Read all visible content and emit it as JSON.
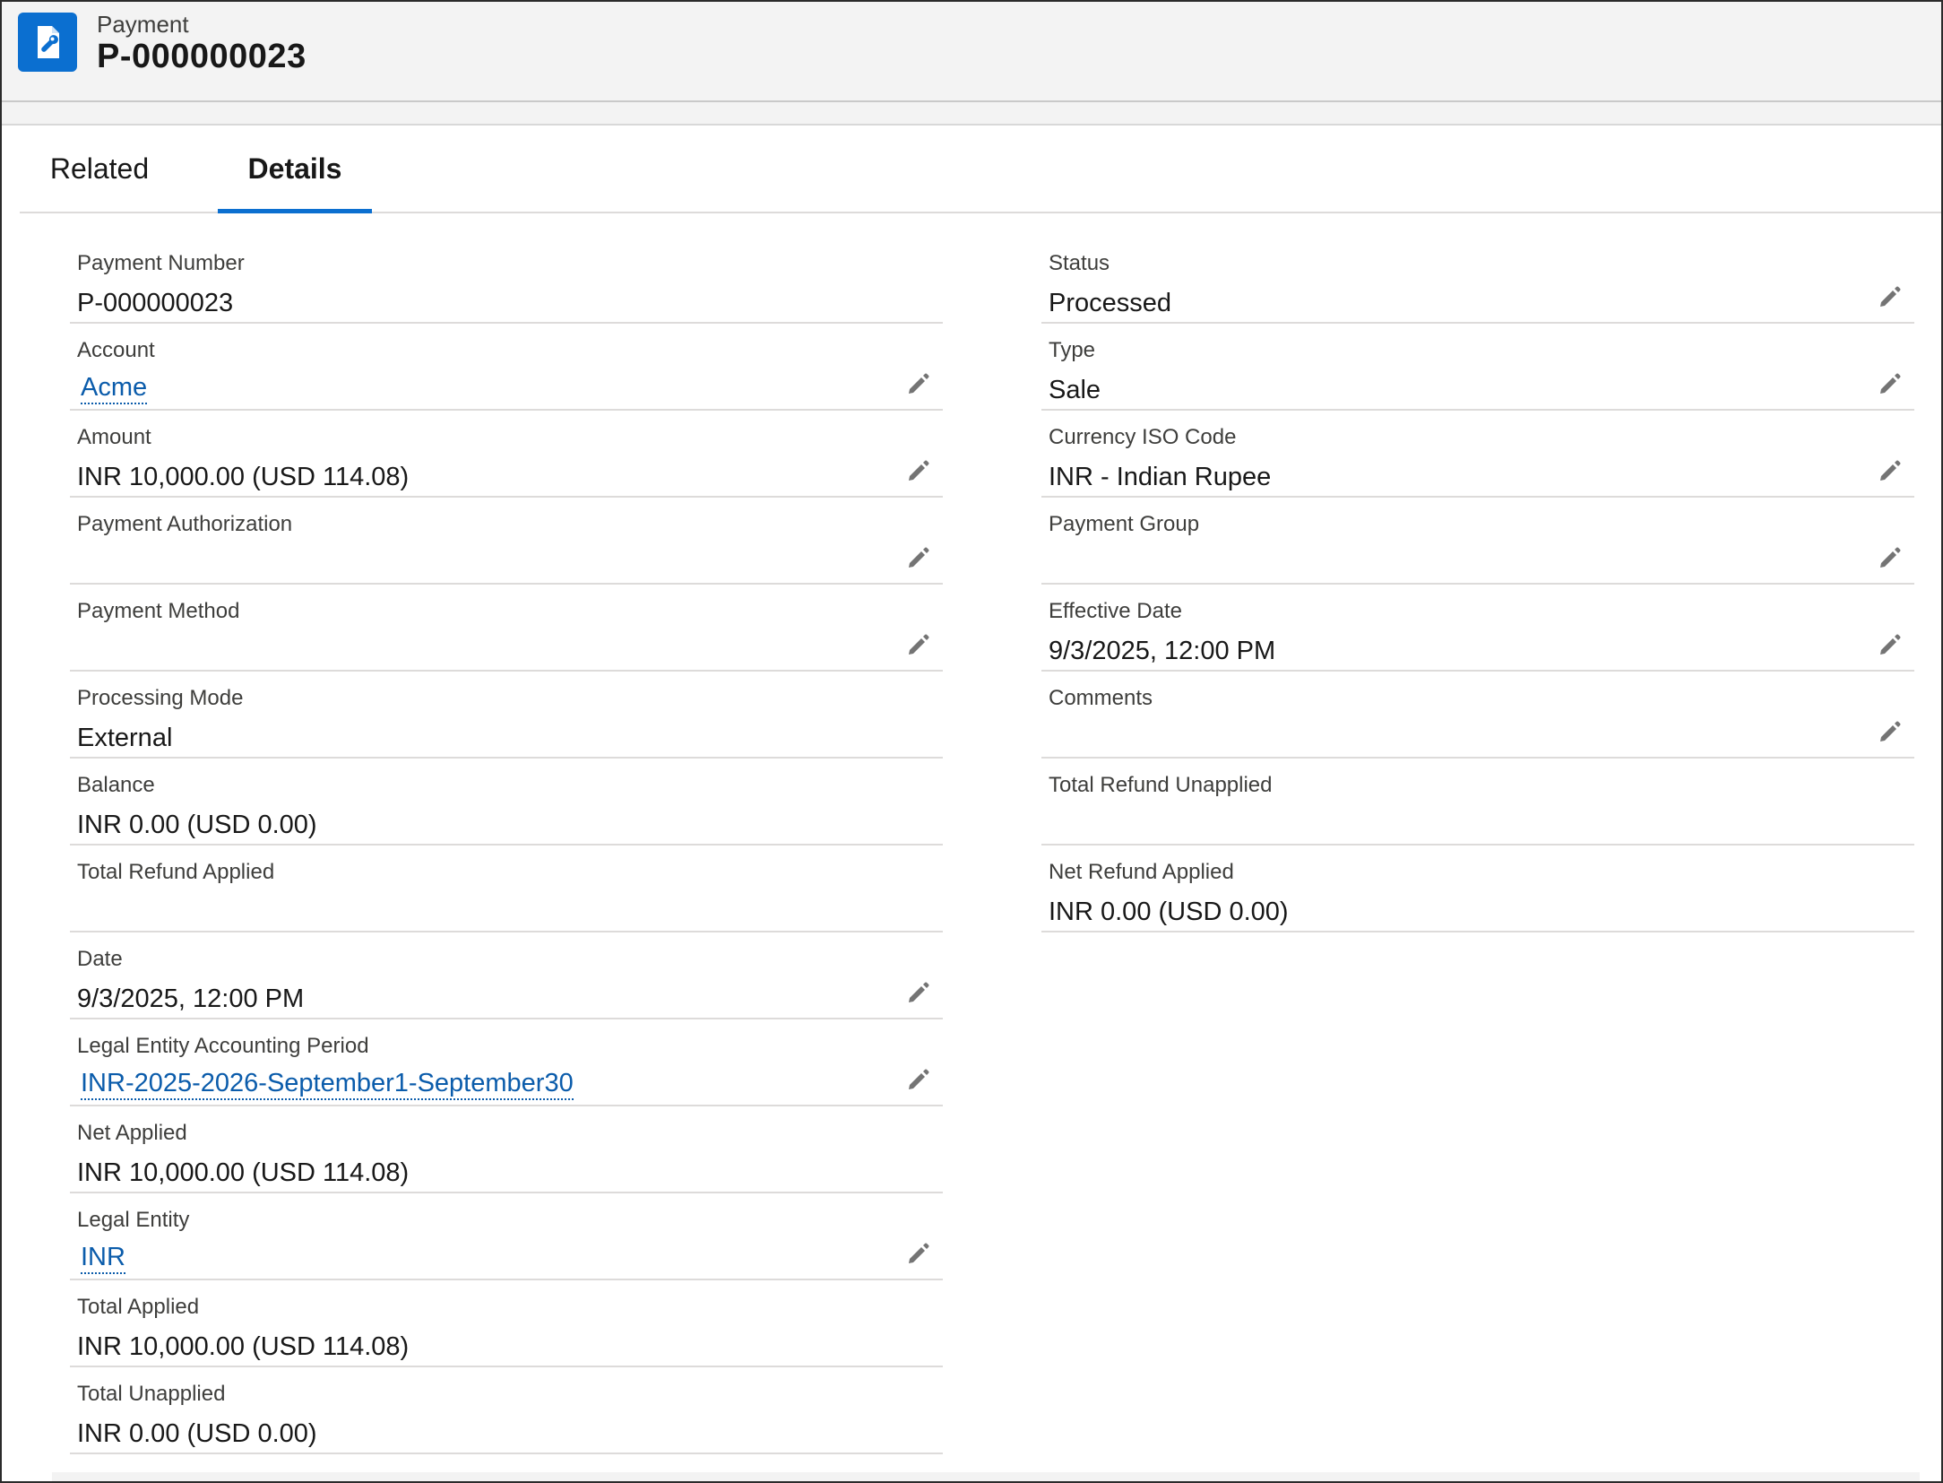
{
  "header": {
    "object_label": "Payment",
    "title": "P-000000023",
    "icon": "payment-wrench-icon"
  },
  "tabs": [
    {
      "label": "Related",
      "active": false
    },
    {
      "label": "Details",
      "active": true
    }
  ],
  "colors": {
    "accent": "#0b6fd0",
    "link": "#0b5cab"
  },
  "left_fields": [
    {
      "label": "Payment Number",
      "value": "P-000000023",
      "link": false,
      "editable": false
    },
    {
      "label": "Account",
      "value": "Acme",
      "link": true,
      "editable": true
    },
    {
      "label": "Amount",
      "value": "INR 10,000.00 (USD 114.08)",
      "link": false,
      "editable": true
    },
    {
      "label": "Payment Authorization",
      "value": "",
      "link": false,
      "editable": true
    },
    {
      "label": "Payment Method",
      "value": "",
      "link": false,
      "editable": true
    },
    {
      "label": "Processing Mode",
      "value": "External",
      "link": false,
      "editable": false
    },
    {
      "label": "Balance",
      "value": "INR 0.00 (USD 0.00)",
      "link": false,
      "editable": false
    },
    {
      "label": "Total Refund Applied",
      "value": "",
      "link": false,
      "editable": false
    },
    {
      "label": "Date",
      "value": "9/3/2025, 12:00 PM",
      "link": false,
      "editable": true
    },
    {
      "label": "Legal Entity Accounting Period",
      "value": "INR-2025-2026-September1-September30",
      "link": true,
      "editable": true
    },
    {
      "label": "Net Applied",
      "value": "INR 10,000.00 (USD 114.08)",
      "link": false,
      "editable": false
    },
    {
      "label": "Legal Entity",
      "value": "INR",
      "link": true,
      "editable": true
    },
    {
      "label": "Total Applied",
      "value": "INR 10,000.00 (USD 114.08)",
      "link": false,
      "editable": false
    },
    {
      "label": "Total Unapplied",
      "value": "INR 0.00 (USD 0.00)",
      "link": false,
      "editable": false
    }
  ],
  "right_fields": [
    {
      "label": "Status",
      "value": "Processed",
      "link": false,
      "editable": true
    },
    {
      "label": "Type",
      "value": "Sale",
      "link": false,
      "editable": true
    },
    {
      "label": "Currency ISO Code",
      "value": "INR - Indian Rupee",
      "link": false,
      "editable": true
    },
    {
      "label": "Payment Group",
      "value": "",
      "link": false,
      "editable": true
    },
    {
      "label": "Effective Date",
      "value": "9/3/2025, 12:00 PM",
      "link": false,
      "editable": true
    },
    {
      "label": "Comments",
      "value": "",
      "link": false,
      "editable": true
    },
    {
      "label": "Total Refund Unapplied",
      "value": "",
      "link": false,
      "editable": false
    },
    {
      "label": "Net Refund Applied",
      "value": "INR 0.00 (USD 0.00)",
      "link": false,
      "editable": false
    }
  ]
}
